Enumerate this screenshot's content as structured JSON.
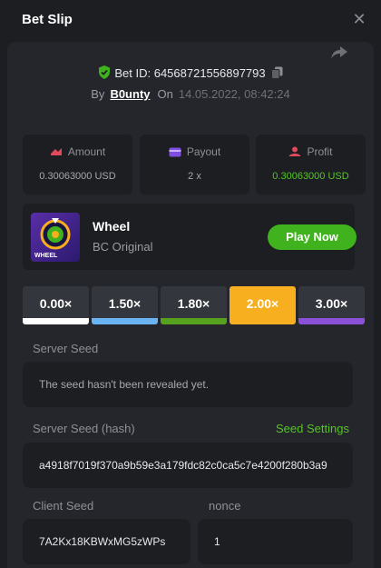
{
  "header": {
    "title": "Bet Slip",
    "close_label": "✕"
  },
  "bet": {
    "id_label": "Bet ID: 64568721556897793",
    "by_label": "By",
    "username": "B0unty",
    "on_label": "On",
    "datetime": "14.05.2022, 08:42:24"
  },
  "stats": {
    "amount": {
      "label": "Amount",
      "value": "0.30063000 USD"
    },
    "payout": {
      "label": "Payout",
      "value": "2 x"
    },
    "profit": {
      "label": "Profit",
      "value": "0.30063000 USD"
    }
  },
  "game": {
    "name": "Wheel",
    "provider": "BC Original",
    "play_label": "Play Now",
    "thumb_text": "WHEEL"
  },
  "multipliers": [
    {
      "label": "0.00×",
      "color": "#ffffff",
      "active": false
    },
    {
      "label": "1.50×",
      "color": "#6ab4f4",
      "active": false
    },
    {
      "label": "1.80×",
      "color": "#56a11e",
      "active": false
    },
    {
      "label": "2.00×",
      "color": "#f7ae1f",
      "active": true
    },
    {
      "label": "3.00×",
      "color": "#8a50d8",
      "active": false
    }
  ],
  "server_seed": {
    "label": "Server Seed",
    "value": "The seed hasn't been revealed yet."
  },
  "server_seed_hash": {
    "label": "Server Seed (hash)",
    "settings_label": "Seed Settings",
    "value": "a4918f7019f370a9b59e3a179fdc82c0ca5c7e4200f280b3a9"
  },
  "client_seed": {
    "label": "Client Seed",
    "value": "7A2Kx18KBWxMG5zWPs"
  },
  "nonce": {
    "label": "nonce",
    "value": "1"
  },
  "colors": {
    "accent_green": "#3fb21d",
    "profit_green": "#56c426",
    "active_multiplier": "#f7ae1f"
  }
}
